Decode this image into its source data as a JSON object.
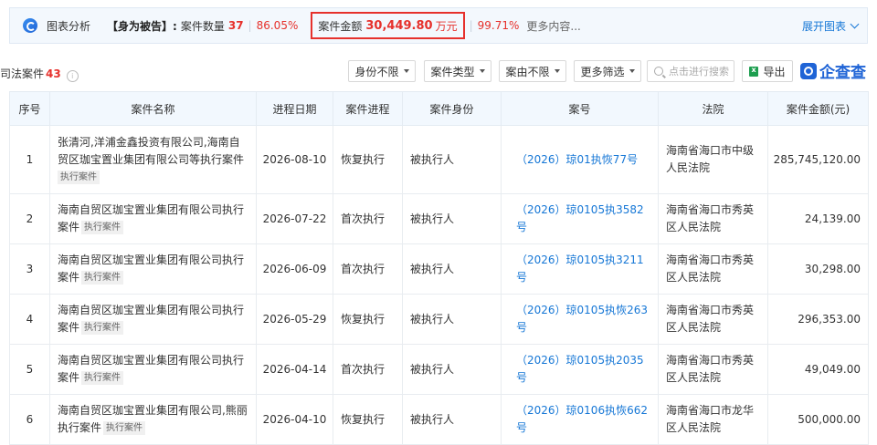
{
  "summary": {
    "title": "图表分析",
    "role": "【身为被告】:",
    "count_label": "案件数量",
    "count": "37",
    "sep": "|",
    "count_pct": "86.05%",
    "amount_label": "案件金额",
    "amount_value": "30,449.80",
    "amount_unit": "万元",
    "amount_pct": "99.71%",
    "more": "更多内容...",
    "expand": "展开图表"
  },
  "toolbar": {
    "case_title": "司法案件",
    "case_count": "43",
    "filters": [
      "身份不限",
      "案件类型",
      "案由不限",
      "更多筛选"
    ],
    "search_placeholder": "点击进行搜索",
    "export": "导出",
    "brand": "企查查"
  },
  "table": {
    "headers": [
      "序号",
      "案件名称",
      "进程日期",
      "案件进程",
      "案件身份",
      "案号",
      "法院",
      "案件金额(元)"
    ],
    "tag": "执行案件",
    "rows": [
      {
        "no": "1",
        "name": "张清河,洋浦金鑫投资有限公司,海南自贸区珈宝置业集团有限公司等执行案件",
        "date": "2026-08-10",
        "progress": "恢复执行",
        "identity": "被执行人",
        "case_no": "（2026）琼01执恢77号",
        "court": "海南省海口市中级人民法院",
        "amount": "285,745,120.00"
      },
      {
        "no": "2",
        "name": "海南自贸区珈宝置业集团有限公司执行案件",
        "date": "2026-07-22",
        "progress": "首次执行",
        "identity": "被执行人",
        "case_no": "（2026）琼0105执3582号",
        "court": "海南省海口市秀英区人民法院",
        "amount": "24,139.00"
      },
      {
        "no": "3",
        "name": "海南自贸区珈宝置业集团有限公司执行案件",
        "date": "2026-06-09",
        "progress": "首次执行",
        "identity": "被执行人",
        "case_no": "（2026）琼0105执3211号",
        "court": "海南省海口市秀英区人民法院",
        "amount": "30,298.00"
      },
      {
        "no": "4",
        "name": "海南自贸区珈宝置业集团有限公司执行案件",
        "date": "2026-05-29",
        "progress": "恢复执行",
        "identity": "被执行人",
        "case_no": "（2026）琼0105执恢263号",
        "court": "海南省海口市秀英区人民法院",
        "amount": "296,353.00"
      },
      {
        "no": "5",
        "name": "海南自贸区珈宝置业集团有限公司执行案件",
        "date": "2026-04-14",
        "progress": "首次执行",
        "identity": "被执行人",
        "case_no": "（2026）琼0105执2035号",
        "court": "海南省海口市秀英区人民法院",
        "amount": "49,049.00"
      },
      {
        "no": "6",
        "name": "海南自贸区珈宝置业集团有限公司,熊丽执行案件",
        "date": "2026-04-10",
        "progress": "恢复执行",
        "identity": "被执行人",
        "case_no": "（2026）琼0106执恢662号",
        "court": "海南省海口市龙华区人民法院",
        "amount": "500,000.00"
      }
    ]
  }
}
